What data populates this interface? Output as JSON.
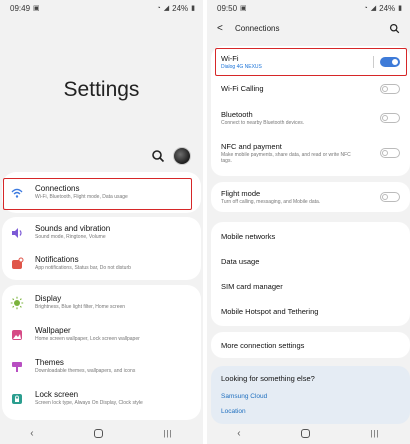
{
  "left": {
    "status": {
      "time": "09:49",
      "battery": "24%"
    },
    "title": "Settings",
    "items": [
      {
        "title": "Connections",
        "subtitle": "Wi-Fi, Bluetooth, Flight mode, Data usage",
        "color": "#3d7be0"
      },
      {
        "title": "Sounds and vibration",
        "subtitle": "Sound mode, Ringtone, Volume",
        "color": "#7c5ad6"
      },
      {
        "title": "Notifications",
        "subtitle": "App notifications, Status bar, Do not disturb",
        "color": "#e0564a"
      },
      {
        "title": "Display",
        "subtitle": "Brightness, Blue light filter, Home screen",
        "color": "#7bb33d"
      },
      {
        "title": "Wallpaper",
        "subtitle": "Home screen wallpaper, Lock screen wallpaper",
        "color": "#d64a86"
      },
      {
        "title": "Themes",
        "subtitle": "Downloadable themes, wallpapers, and icons",
        "color": "#b84fc2"
      },
      {
        "title": "Lock screen",
        "subtitle": "Screen lock type, Always On Display, Clock style",
        "color": "#2b9e8f"
      }
    ]
  },
  "right": {
    "status": {
      "time": "09:50",
      "battery": "24%"
    },
    "header": {
      "title": "Connections"
    },
    "wifi": {
      "label": "Wi-Fi",
      "network": "Dialog 4G NEXUS",
      "on": true
    },
    "wifi_calling": {
      "label": "Wi-Fi Calling"
    },
    "bluetooth": {
      "label": "Bluetooth",
      "subtitle": "Connect to nearby Bluetooth devices."
    },
    "nfc": {
      "label": "NFC and payment",
      "subtitle": "Make mobile payments, share data, and read or write NFC tags."
    },
    "flight": {
      "label": "Flight mode",
      "subtitle": "Turn off calling, messaging, and Mobile data."
    },
    "list": [
      "Mobile networks",
      "Data usage",
      "SIM card manager",
      "Mobile Hotspot and Tethering"
    ],
    "more": "More connection settings",
    "looking": {
      "question": "Looking for something else?",
      "link1": "Samsung Cloud",
      "link2": "Location"
    }
  }
}
